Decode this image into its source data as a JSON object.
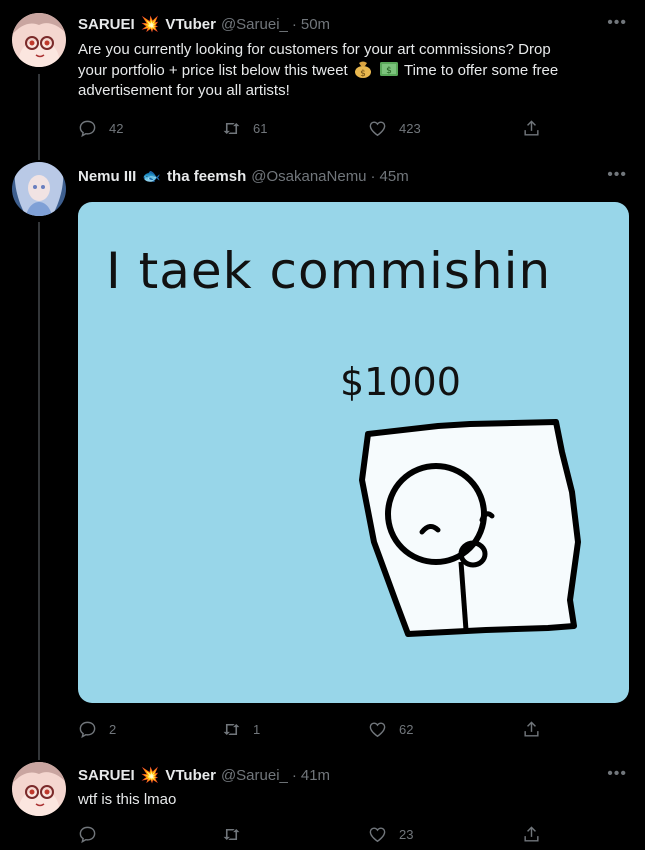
{
  "tweets": [
    {
      "name": "SARUEI",
      "name_suffix": "VTuber",
      "handle": "@Saruei_",
      "time": "50m",
      "text": [
        "Are you currently looking for customers for your art commissions? Drop",
        "your portfolio + price list below this tweet",
        "Time to offer some free",
        "advertisement for you all artists!"
      ],
      "replies": "42",
      "retweets": "61",
      "likes": "423"
    },
    {
      "name": "Nemu III",
      "name_suffix": "tha feemsh",
      "handle": "@OsakanaNemu",
      "time": "45m",
      "media_text": "I taek commishin",
      "media_price": "$1000",
      "replies": "2",
      "retweets": "1",
      "likes": "62"
    },
    {
      "name": "SARUEI",
      "name_suffix": "VTuber",
      "handle": "@Saruei_",
      "time": "41m",
      "text": "wtf is this lmao",
      "replies": "",
      "retweets": "",
      "likes": "23"
    }
  ],
  "icons": {
    "name_emoji_saruei": "collision",
    "name_emoji_nemu": "fish",
    "text_emoji": [
      "money-bag",
      "dollar-banknote"
    ],
    "more": "more-icon",
    "reply": "reply-icon",
    "retweet": "retweet-icon",
    "like": "heart-icon",
    "share": "share-icon"
  },
  "colors": {
    "background": "#000000",
    "text_primary": "#e7e9ea",
    "text_secondary": "#71767b",
    "media_background": "#98d6e9"
  }
}
